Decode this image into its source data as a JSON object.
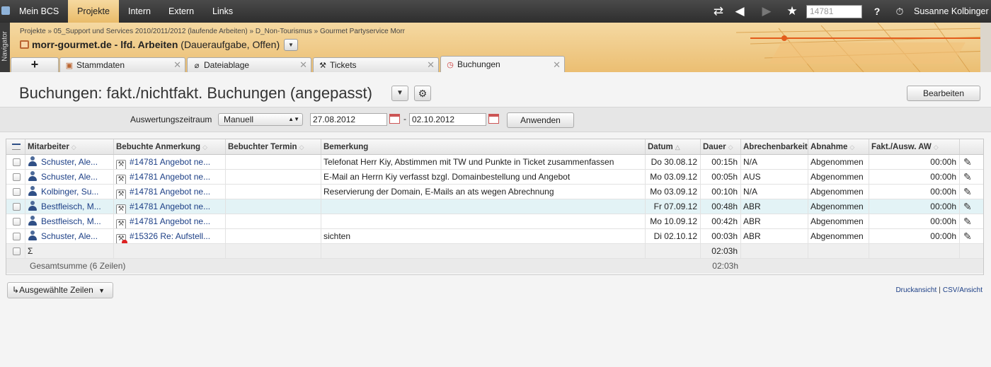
{
  "nav": {
    "items": [
      "Mein BCS",
      "Projekte",
      "Intern",
      "Extern",
      "Links"
    ],
    "active": "Projekte",
    "search_placeholder": "14781",
    "help": "?",
    "user": "Susanne Kolbinger"
  },
  "navigator_label": "Navigator",
  "breadcrumb": "Projekte  »  05_Support und Services 2010/2011/2012 (laufende Arbeiten)  »  D_Non-Tourismus  »  Gourmet Partyservice Morr",
  "project": {
    "name": "morr-gourmet.de - lfd. Arbeiten",
    "status": "(Daueraufgabe, Offen)"
  },
  "tabs": {
    "stammdaten": "Stammdaten",
    "dateiablage": "Dateiablage",
    "tickets": "Tickets",
    "buchungen": "Buchungen"
  },
  "page": {
    "title": "Buchungen: fakt./nichtfakt. Buchungen (angepasst)",
    "edit_button": "Bearbeiten"
  },
  "filter": {
    "label": "Auswertungszeitraum",
    "mode": "Manuell",
    "from": "27.08.2012",
    "to": "02.10.2012",
    "apply": "Anwenden"
  },
  "table": {
    "headers": {
      "mitarbeiter": "Mitarbeiter",
      "anmerkung": "Bebuchte Anmerkung",
      "termin": "Bebuchter Termin",
      "bemerkung": "Bemerkung",
      "datum": "Datum",
      "dauer": "Dauer",
      "abrechenbarkeit": "Abrechenbarkeit",
      "abnahme": "Abnahme",
      "fakt": "Fakt./Ausw. AW"
    },
    "rows": [
      {
        "mitarbeiter": "Schuster, Ale...",
        "anmerkung": "#14781 Angebot ne...",
        "termin": "",
        "bemerkung": "Telefonat Herr Kiy, Abstimmen mit TW und Punkte in Ticket zusammenfassen",
        "datum": "Do 30.08.12",
        "dauer": "00:15h",
        "abrechenbarkeit": "N/A",
        "abnahme": "Abgenommen",
        "fakt": "00:00h"
      },
      {
        "mitarbeiter": "Schuster, Ale...",
        "anmerkung": "#14781 Angebot ne...",
        "termin": "",
        "bemerkung": "E-Mail an Herrn Kiy verfasst bzgl. Domainbestellung und Angebot",
        "datum": "Mo 03.09.12",
        "dauer": "00:05h",
        "abrechenbarkeit": "AUS",
        "abnahme": "Abgenommen",
        "fakt": "00:00h"
      },
      {
        "mitarbeiter": "Kolbinger, Su...",
        "anmerkung": "#14781 Angebot ne...",
        "termin": "",
        "bemerkung": "Reservierung der Domain, E-Mails an ats wegen Abrechnung",
        "datum": "Mo 03.09.12",
        "dauer": "00:10h",
        "abrechenbarkeit": "N/A",
        "abnahme": "Abgenommen",
        "fakt": "00:00h"
      },
      {
        "mitarbeiter": "Bestfleisch, M...",
        "anmerkung": "#14781 Angebot ne...",
        "termin": "",
        "bemerkung": "",
        "datum": "Fr 07.09.12",
        "dauer": "00:48h",
        "abrechenbarkeit": "ABR",
        "abnahme": "Abgenommen",
        "fakt": "00:00h"
      },
      {
        "mitarbeiter": "Bestfleisch, M...",
        "anmerkung": "#14781 Angebot ne...",
        "termin": "",
        "bemerkung": "",
        "datum": "Mo 10.09.12",
        "dauer": "00:42h",
        "abrechenbarkeit": "ABR",
        "abnahme": "Abgenommen",
        "fakt": "00:00h"
      },
      {
        "mitarbeiter": "Schuster, Ale...",
        "anmerkung": "#15326 Re: Aufstell...",
        "termin": "",
        "bemerkung": "sichten",
        "datum": "Di 02.10.12",
        "dauer": "00:03h",
        "abrechenbarkeit": "ABR",
        "abnahme": "Abgenommen",
        "fakt": "00:00h"
      }
    ],
    "sum_symbol": "Σ",
    "sum_dauer": "02:03h",
    "total_label": "Gesamtsumme (6 Zeilen)",
    "total_dauer": "02:03h"
  },
  "footer": {
    "selected_rows": "Ausgewählte Zeilen",
    "print": "Druckansicht",
    "separator": "|",
    "csv": "CSV/Ansicht"
  }
}
